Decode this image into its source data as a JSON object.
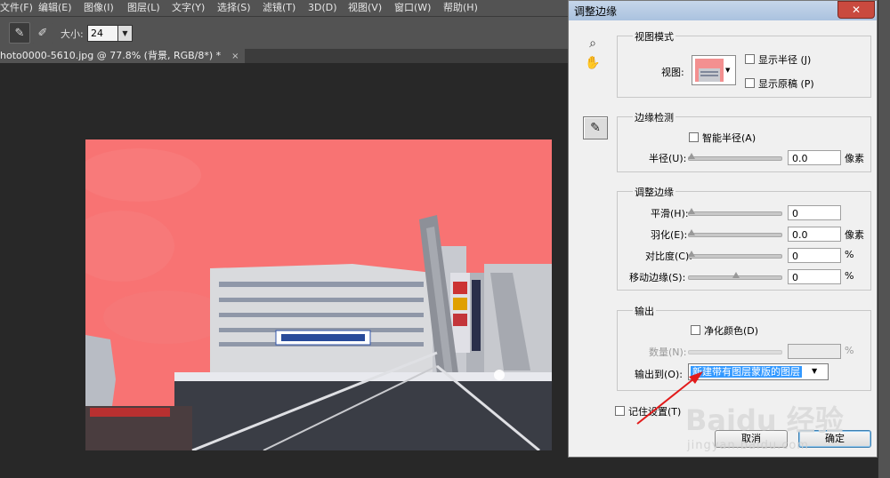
{
  "menu": [
    "文件(F)",
    "编辑(E)",
    "图像(I)",
    "图层(L)",
    "文字(Y)",
    "选择(S)",
    "滤镜(T)",
    "3D(D)",
    "视图(V)",
    "窗口(W)",
    "帮助(H)"
  ],
  "options": {
    "size_label": "大小:",
    "size_value": "24"
  },
  "document": {
    "tab_title": "hoto0000-5610.jpg @ 77.8% (背景, RGB/8*) *",
    "close": "×"
  },
  "dialog": {
    "title": "调整边缘",
    "close": "✕",
    "view_mode": {
      "group_title": "视图模式",
      "view_label": "视图:",
      "show_radius": "显示半径 (J)",
      "show_original": "显示原稿 (P)"
    },
    "edge_detection": {
      "group_title": "边缘检测",
      "smart_radius": "智能半径(A)",
      "radius_label": "半径(U):",
      "radius_value": "0.0",
      "radius_unit": "像素"
    },
    "adjust_edge": {
      "group_title": "调整边缘",
      "smooth_label": "平滑(H):",
      "smooth_value": "0",
      "feather_label": "羽化(E):",
      "feather_value": "0.0",
      "feather_unit": "像素",
      "contrast_label": "对比度(C):",
      "contrast_value": "0",
      "contrast_unit": "%",
      "shift_label": "移动边缘(S):",
      "shift_value": "0",
      "shift_unit": "%"
    },
    "output": {
      "group_title": "输出",
      "decontaminate": "净化颜色(D)",
      "amount_label": "数量(N):",
      "amount_unit": "%",
      "output_to_label": "输出到(O):",
      "output_to_value": "新建带有图层蒙版的图层"
    },
    "remember": "记住设置(T)",
    "cancel": "取消",
    "ok": "确定"
  },
  "watermark": {
    "main": "Baidu 经验",
    "sub": "jingyan.baidu.com"
  },
  "colors": {
    "overlay_red": "#f87373",
    "accent_blue": "#3399ff",
    "arrow_red": "#e21b1b"
  }
}
